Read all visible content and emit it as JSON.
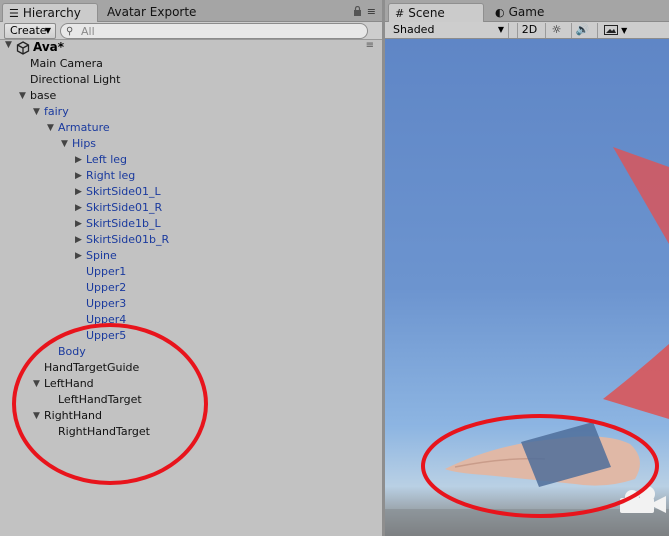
{
  "hierarchy": {
    "tabs": [
      {
        "label": "Hierarchy",
        "icon": "list-icon",
        "active": true
      },
      {
        "label": "Avatar Exporte",
        "active": false
      }
    ],
    "toolbar": {
      "create_label": "Create",
      "search_placeholder": "All"
    },
    "scene": {
      "name": "Ava*",
      "icon": "unity-logo-icon"
    },
    "tree": [
      {
        "label": "Main Camera",
        "depth": 1,
        "color": "black",
        "arrow": "none"
      },
      {
        "label": "Directional Light",
        "depth": 1,
        "color": "black",
        "arrow": "none"
      },
      {
        "label": "base",
        "depth": 1,
        "color": "black",
        "arrow": "expanded"
      },
      {
        "label": "fairy",
        "depth": 2,
        "color": "blue",
        "arrow": "expanded"
      },
      {
        "label": "Armature",
        "depth": 3,
        "color": "blue",
        "arrow": "expanded"
      },
      {
        "label": "Hips",
        "depth": 4,
        "color": "blue",
        "arrow": "expanded"
      },
      {
        "label": "Left leg",
        "depth": 5,
        "color": "blue",
        "arrow": "collapsed"
      },
      {
        "label": "Right leg",
        "depth": 5,
        "color": "blue",
        "arrow": "collapsed"
      },
      {
        "label": "SkirtSide01_L",
        "depth": 5,
        "color": "blue",
        "arrow": "collapsed"
      },
      {
        "label": "SkirtSide01_R",
        "depth": 5,
        "color": "blue",
        "arrow": "collapsed"
      },
      {
        "label": "SkirtSide1b_L",
        "depth": 5,
        "color": "blue",
        "arrow": "collapsed"
      },
      {
        "label": "SkirtSide01b_R",
        "depth": 5,
        "color": "blue",
        "arrow": "collapsed"
      },
      {
        "label": "Spine",
        "depth": 5,
        "color": "blue",
        "arrow": "collapsed"
      },
      {
        "label": "Upper1",
        "depth": 5,
        "color": "blue",
        "arrow": "none"
      },
      {
        "label": "Upper2",
        "depth": 5,
        "color": "blue",
        "arrow": "none"
      },
      {
        "label": "Upper3",
        "depth": 5,
        "color": "blue",
        "arrow": "none"
      },
      {
        "label": "Upper4",
        "depth": 5,
        "color": "blue",
        "arrow": "none"
      },
      {
        "label": "Upper5",
        "depth": 5,
        "color": "blue",
        "arrow": "none"
      },
      {
        "label": "Body",
        "depth": 3,
        "color": "blue",
        "arrow": "none"
      },
      {
        "label": "HandTargetGuide",
        "depth": 2,
        "color": "black",
        "arrow": "none"
      },
      {
        "label": "LeftHand",
        "depth": 2,
        "color": "black",
        "arrow": "expanded"
      },
      {
        "label": "LeftHandTarget",
        "depth": 3,
        "color": "black",
        "arrow": "none"
      },
      {
        "label": "RightHand",
        "depth": 2,
        "color": "black",
        "arrow": "expanded"
      },
      {
        "label": "RightHandTarget",
        "depth": 3,
        "color": "black",
        "arrow": "none"
      }
    ]
  },
  "scene_view": {
    "tabs": [
      {
        "label": "Scene",
        "icon": "grid-icon",
        "active": true
      },
      {
        "label": "Game",
        "icon": "pacman-icon",
        "active": false
      }
    ],
    "toolbar": {
      "shading_mode": "Shaded",
      "mode_2d": "2D",
      "lighting_icon": "sun-icon",
      "audio_icon": "speaker-icon",
      "effects_icon": "image-icon"
    },
    "gizmo_icon": "camera-icon"
  },
  "annotation_color": "#e8141c",
  "colors": {
    "unity_blue_text": "#1a3a9e",
    "sky_top": "#5f86c6",
    "sky_bottom": "#b9d0e4",
    "cube_color": "#4e6d9a"
  }
}
